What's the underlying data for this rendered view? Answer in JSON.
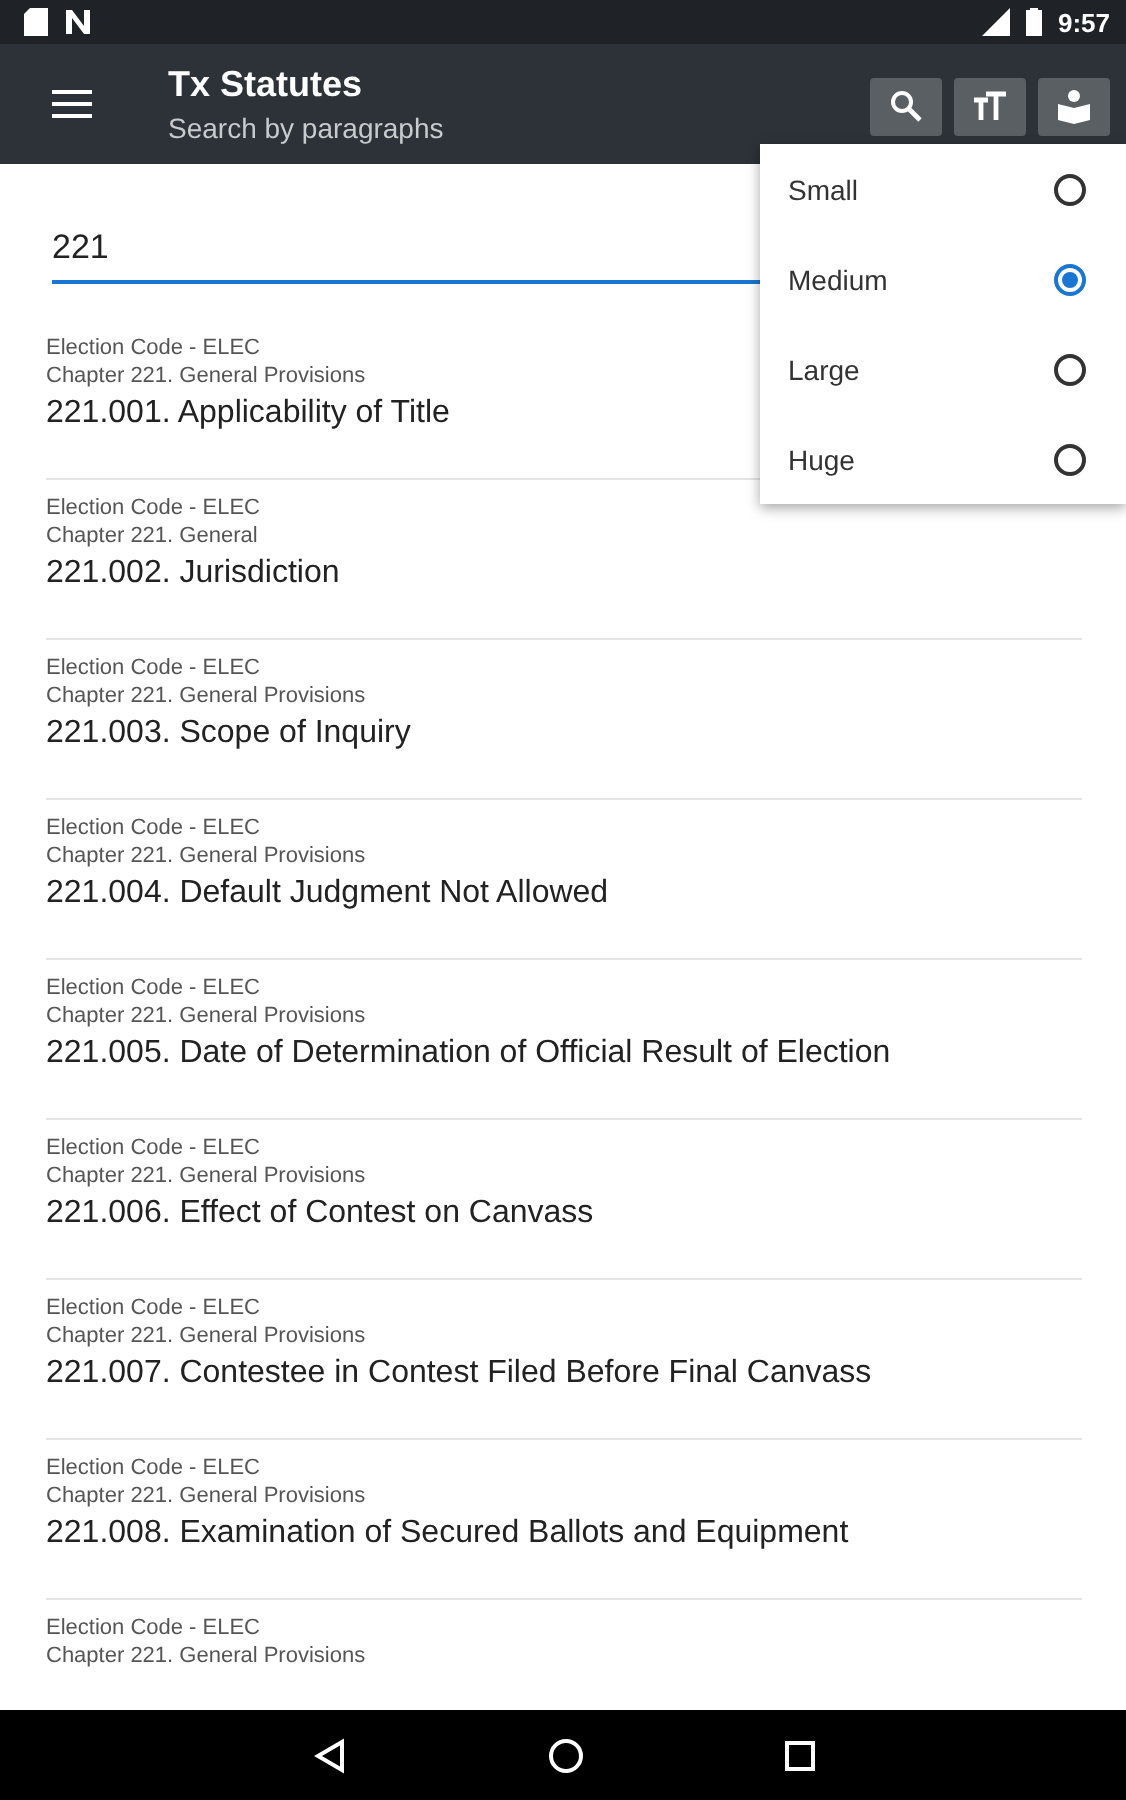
{
  "status_bar": {
    "time": "9:57"
  },
  "app_bar": {
    "title": "Tx Statutes",
    "subtitle": "Search by paragraphs"
  },
  "search": {
    "value": "221"
  },
  "results": [
    {
      "code": "Election Code - ELEC",
      "chapter": "Chapter 221. General Provisions",
      "title": "221.001. Applicability of Title"
    },
    {
      "code": "Election Code - ELEC",
      "chapter": "Chapter 221. General",
      "title": "221.002. Jurisdiction"
    },
    {
      "code": "Election Code - ELEC",
      "chapter": "Chapter 221. General Provisions",
      "title": "221.003. Scope of Inquiry"
    },
    {
      "code": "Election Code - ELEC",
      "chapter": "Chapter 221. General Provisions",
      "title": "221.004. Default Judgment Not Allowed"
    },
    {
      "code": "Election Code - ELEC",
      "chapter": "Chapter 221. General Provisions",
      "title": "221.005. Date of Determination of Official Result of Election"
    },
    {
      "code": "Election Code - ELEC",
      "chapter": "Chapter 221. General Provisions",
      "title": "221.006. Effect of Contest on Canvass"
    },
    {
      "code": "Election Code - ELEC",
      "chapter": "Chapter 221. General Provisions",
      "title": "221.007. Contestee in Contest Filed Before Final Canvass"
    },
    {
      "code": "Election Code - ELEC",
      "chapter": "Chapter 221. General Provisions",
      "title": "221.008. Examination of Secured Ballots and Equipment"
    },
    {
      "code": "Election Code - ELEC",
      "chapter": "Chapter 221. General Provisions"
    }
  ],
  "text_size_menu": [
    {
      "label": "Small",
      "selected": false
    },
    {
      "label": "Medium",
      "selected": true
    },
    {
      "label": "Large",
      "selected": false
    },
    {
      "label": "Huge",
      "selected": false
    }
  ]
}
